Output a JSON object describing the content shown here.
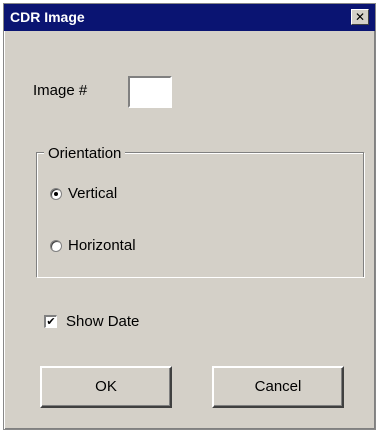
{
  "window": {
    "title": "CDR Image",
    "close_glyph": "✕"
  },
  "image_field": {
    "label": "Image #",
    "value": ""
  },
  "orientation": {
    "legend": "Orientation",
    "options": [
      {
        "label": "Vertical",
        "selected": true
      },
      {
        "label": "Horizontal",
        "selected": false
      }
    ]
  },
  "show_date": {
    "label": "Show Date",
    "checked": true,
    "check_glyph": "✔"
  },
  "buttons": {
    "ok": "OK",
    "cancel": "Cancel"
  }
}
